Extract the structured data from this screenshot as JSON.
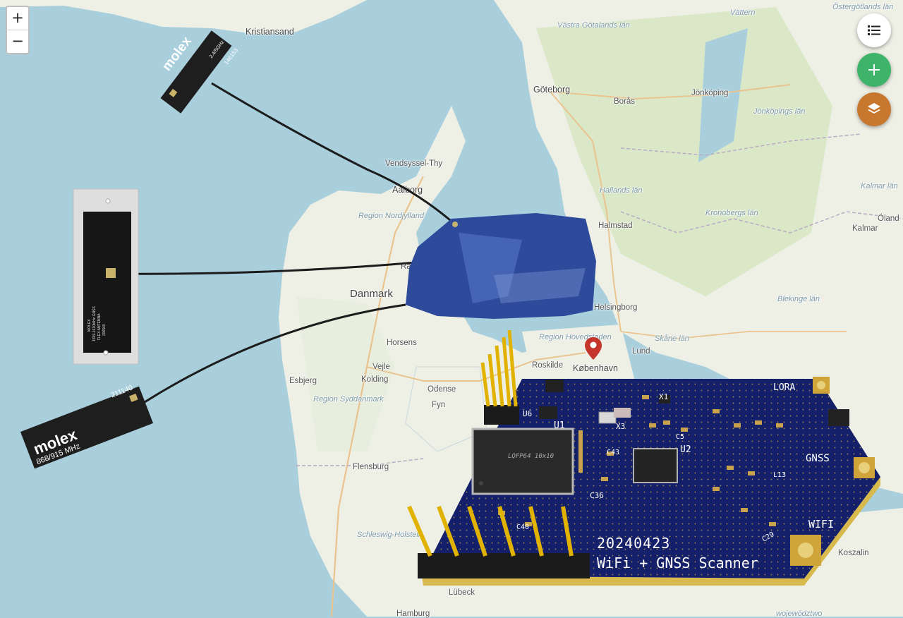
{
  "map": {
    "zoom_in_label": "+",
    "zoom_out_label": "−",
    "places": {
      "kristiansand": "Kristiansand",
      "goteborg": "Göteborg",
      "vastra_gotaland": "Västra Götalands län",
      "boras": "Borås",
      "jonkoping": "Jönköping",
      "jonkopings_lan": "Jönköpings län",
      "vattern": "Vättern",
      "ostergotland": "Östergötlands län",
      "hallands_lan": "Hallands län",
      "kronobergs_lan": "Kronobergs län",
      "kalmar_lan": "Kalmar län",
      "kalmar": "Kalmar",
      "oland": "Öland",
      "halmstad": "Halmstad",
      "blekinge": "Blekinge län",
      "skane": "Skåne län",
      "lund": "Lund",
      "helsingborg": "Helsingborg",
      "vendsyssel": "Vendsyssel-Thy",
      "aalborg": "Aalborg",
      "nordjylland": "Region Nordjylland",
      "danmark": "Danmark",
      "horsens": "Horsens",
      "hovedstaden": "Region Hovedstaden",
      "roskilde": "Roskilde",
      "kobenhavn": "København",
      "esbjerg": "Esbjerg",
      "vejle": "Vejle",
      "kolding": "Kolding",
      "odense": "Odense",
      "fyn": "Fyn",
      "syddanmark": "Region Syddanmark",
      "flensburg": "Flensburg",
      "schleswig": "Schleswig-Holstein",
      "lubeck": "Lübeck",
      "hamburg": "Hamburg",
      "koszalin": "Koszalin",
      "wojewodztwo": "województwo",
      "ra": "Ra"
    },
    "colors": {
      "sea": "#a9cfdd",
      "land": "#eef0e6",
      "forest": "#cfe2b8",
      "marker": "#c6352b"
    },
    "marker_icon": "map-pin-icon"
  },
  "fab": {
    "list_icon": "list-icon",
    "add_icon": "plus-icon",
    "layers_icon": "layers-icon",
    "list_color": "#ffffff",
    "add_color": "#3db46a",
    "layers_color": "#c8782e"
  },
  "antennas": {
    "top": {
      "brand": "molex",
      "freq": "2.4/5GHz",
      "part": "146153"
    },
    "middle": {
      "brand": "MOLEX",
      "line1": "1559-1610MHz GNSS",
      "line2": "FLEX ANTENNA",
      "part": "206560"
    },
    "bottom": {
      "brand": "molex",
      "freq": "868/915 MHz",
      "part": "211140"
    }
  },
  "board": {
    "date": "20240423",
    "title": "WiFi + GNSS Scanner",
    "label_lora": "LORA",
    "label_gnss": "GNSS",
    "label_wifi": "WIFI",
    "label_u1": "U1",
    "label_u2": "U2",
    "label_u6": "U6",
    "label_x3": "X3",
    "label_x1": "X1",
    "label_c36": "C36",
    "label_c40": "C40",
    "label_c43": "C43",
    "label_c5": "C5",
    "label_l13": "L13",
    "label_c29": "C29",
    "chip_label": "LQFP64 10x10"
  }
}
